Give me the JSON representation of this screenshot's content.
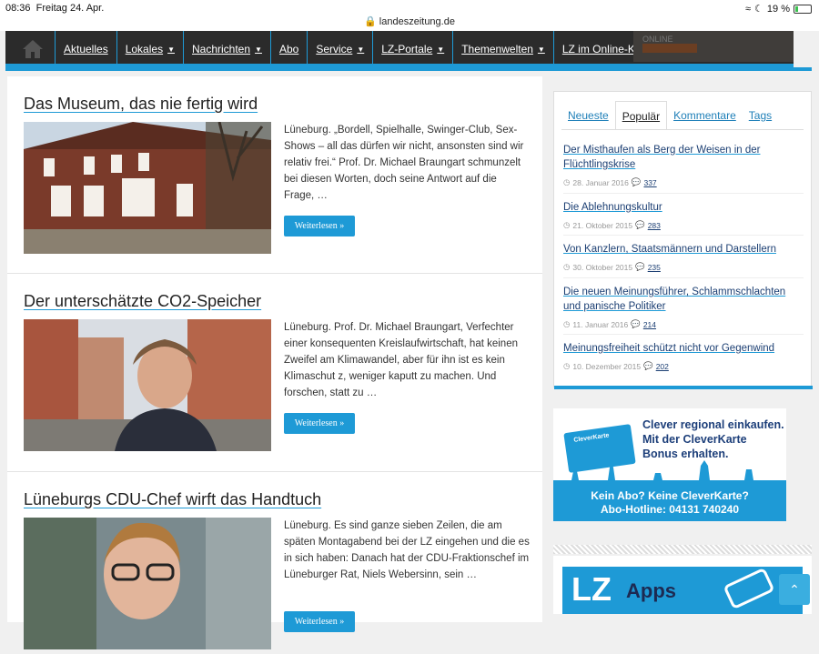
{
  "status_bar": {
    "time": "08:36",
    "date": "Freitag 24. Apr.",
    "url": "landeszeitung.de",
    "battery": "19 %",
    "battery_level": 0.19
  },
  "nav": {
    "home_icon": "home-icon",
    "items": [
      {
        "label": "Aktuelles",
        "dropdown": false
      },
      {
        "label": "Lokales",
        "dropdown": true
      },
      {
        "label": "Nachrichten",
        "dropdown": true
      },
      {
        "label": "Abo",
        "dropdown": false
      },
      {
        "label": "Service",
        "dropdown": true
      },
      {
        "label": "LZ-Portale",
        "dropdown": true
      },
      {
        "label": "Themenwelten",
        "dropdown": true
      },
      {
        "label": "LZ im Online-Kiosk",
        "dropdown": false
      }
    ],
    "ad_label": "ONLINE"
  },
  "posts": [
    {
      "title": "Das Museum, das nie fertig wird",
      "excerpt": "Lüneburg. „Bordell, Spielhalle, Swinger-Club, Sex-Shows – all das dürfen wir nicht, ansonsten sind wir relativ frei.“ Prof. Dr. Michael Braungart schmunzelt bei diesen Worten, doch seine Antwort auf die Frage, …",
      "more": "Weiterlesen »"
    },
    {
      "title": "Der unterschätzte CO2-Speicher",
      "excerpt": "Lüneburg. Prof. Dr. Michael Braungart, Verfechter einer konsequenten Kreislaufwirtschaft, hat keinen Zweifel am Klimawandel, aber für ihn ist es kein Klimaschut z, weniger kaputt zu machen. Und forschen, statt zu …",
      "more": "Weiterlesen »"
    },
    {
      "title": "Lüneburgs CDU-Chef wirft das Handtuch",
      "excerpt": "Lüneburg. Es sind ganze sieben Zeilen, die am späten Montagabend bei der LZ eingehen und die es in sich haben: Danach hat der CDU-Fraktionschef im Lüneburger Rat, Niels Webersinn, sein …",
      "more": "Weiterlesen »"
    }
  ],
  "sidebar": {
    "tabs": [
      "Neueste",
      "Populär",
      "Kommentare",
      "Tags"
    ],
    "active_tab": "Populär",
    "popular": [
      {
        "title": "Der Misthaufen als Berg der Weisen in der Flüchtlingskrise",
        "date": "28. Januar 2016",
        "comments": "337"
      },
      {
        "title": "Die Ablehnungskultur",
        "date": "21. Oktober 2015",
        "comments": "283"
      },
      {
        "title": "Von Kanzlern, Staatsmännern und Darstellern",
        "date": "30. Oktober 2015",
        "comments": "235"
      },
      {
        "title": "Die neuen Meinungsführer, Schlammschlachten und panische Politiker",
        "date": "11. Januar 2016",
        "comments": "214"
      },
      {
        "title": "Meinungsfreiheit schützt nicht vor Gegenwind",
        "date": "10. Dezember 2015",
        "comments": "202"
      }
    ]
  },
  "banner": {
    "line1": "Clever regional einkaufen.",
    "line2": "Mit der CleverKarte",
    "line3": "Bonus erhalten.",
    "card_label": "CleverKarte",
    "bottom1": "Kein Abo? Keine CleverKarte?",
    "bottom2": "Abo-Hotline: 04131 740240"
  },
  "apps": {
    "logo": "LZ",
    "label": "Apps"
  }
}
